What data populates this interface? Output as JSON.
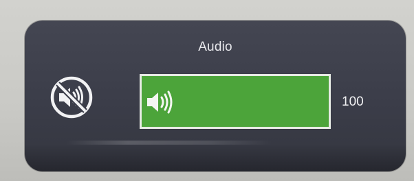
{
  "osd": {
    "title": "Audio",
    "volume_value": "100",
    "volume_level": 1.0
  },
  "icons": {
    "mute_toggle": "speaker-muted-icon",
    "bar_speaker": "speaker-icon"
  },
  "colors": {
    "panel": "#3b3d49",
    "bar_fill": "#4ca43a",
    "bar_border": "#e7ebe5",
    "text": "#f0f0f2"
  }
}
